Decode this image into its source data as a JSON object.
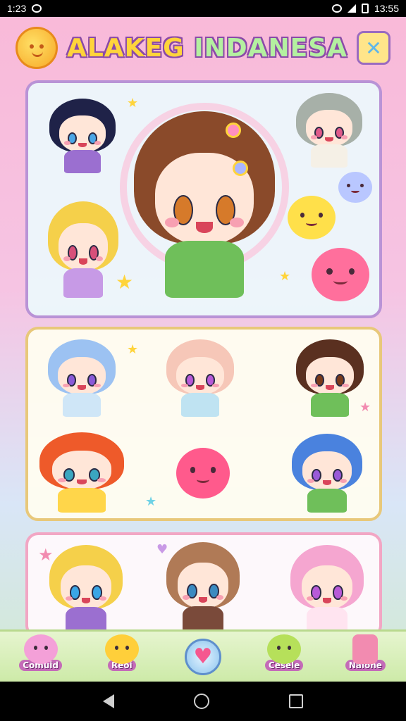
{
  "status_bar": {
    "time_left": "1:23",
    "time_right": "13:55"
  },
  "header": {
    "title_part1": "ALAKEG",
    "title_part2": "INDANESA",
    "sun_icon": "sun-icon",
    "tools_icon": "tools-icon"
  },
  "panels": [
    {
      "name": "featured-panel",
      "border": "#b993d6"
    },
    {
      "name": "collection-panel",
      "border": "#e8c87a"
    },
    {
      "name": "more-panel",
      "border": "#f2a6c4"
    }
  ],
  "bottom_nav": {
    "items": [
      {
        "label": "Comuid",
        "icon": "pink-blob-icon",
        "color": "#f4a0d8"
      },
      {
        "label": "Reoi",
        "icon": "yellow-blob-icon",
        "color": "#ffcf3a"
      },
      {
        "label": "",
        "icon": "heart-icon",
        "color": "#f5578f"
      },
      {
        "label": "Cesele",
        "icon": "green-blob-icon",
        "color": "#b6e05a"
      },
      {
        "label": "Naione",
        "icon": "marker-icon",
        "color": "#f28bb0"
      }
    ]
  },
  "system_nav": {
    "back": "back-icon",
    "home": "home-icon",
    "recent": "recent-apps-icon"
  }
}
